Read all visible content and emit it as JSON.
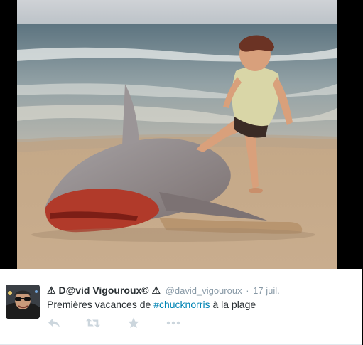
{
  "tweet": {
    "warn_prefix": "⚠ ",
    "fullname": "D@vid Vigouroux©",
    "warn_suffix": " ⚠",
    "username": "@david_vigouroux",
    "separator": "·",
    "timestamp": "17 juil.",
    "text_before": "Premières vacances de ",
    "hashtag": "#chucknorris",
    "text_after": " à la plage",
    "hashtag_color": "#0084b4"
  },
  "actions": {
    "reply_icon": "reply-icon",
    "retweet_icon": "retweet-icon",
    "favorite_icon": "star-icon",
    "more_icon": "more-icon"
  },
  "colors": {
    "meta_gray": "#8899a6",
    "icon_gray": "#ccd6dd",
    "text": "#292f33"
  }
}
